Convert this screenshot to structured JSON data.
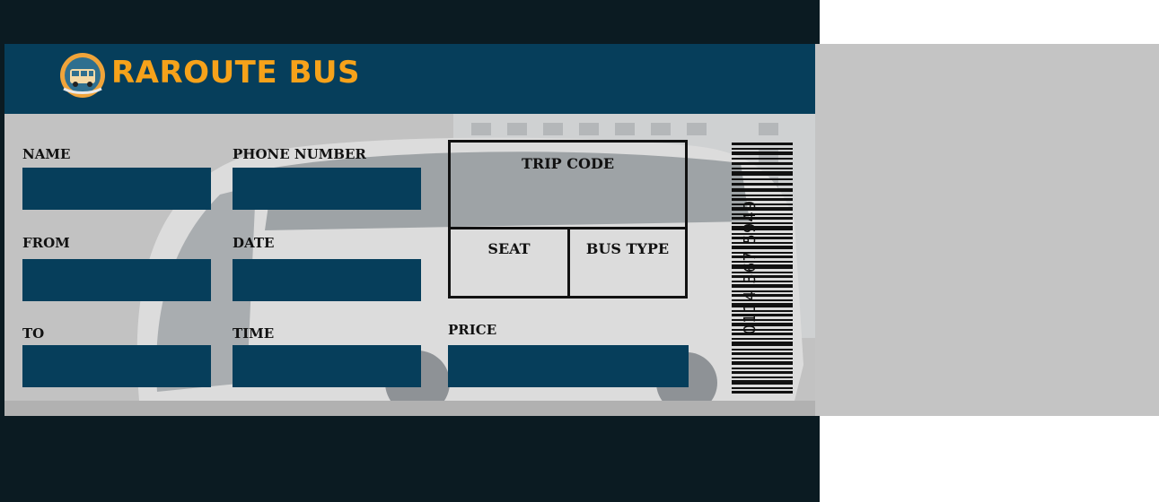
{
  "brand": {
    "name": "RAROUTE BUS",
    "logo_icon": "bus-emblem-icon"
  },
  "fields": {
    "name_label": "NAME",
    "phone_label": "PHONE NUMBER",
    "from_label": "FROM",
    "date_label": "DATE",
    "to_label": "TO",
    "time_label": "TIME",
    "price_label": "PRICE"
  },
  "trip_box": {
    "trip_code_label": "TRIP CODE",
    "seat_label": "SEAT",
    "bus_type_label": "BUS TYPE"
  },
  "barcode": {
    "number": "0114 367 5949"
  },
  "colors": {
    "header": "#063e5b",
    "field": "#063e5b",
    "brand": "#f6a21a",
    "frame": "#0b1b22",
    "stub": "#c4c4c4"
  }
}
